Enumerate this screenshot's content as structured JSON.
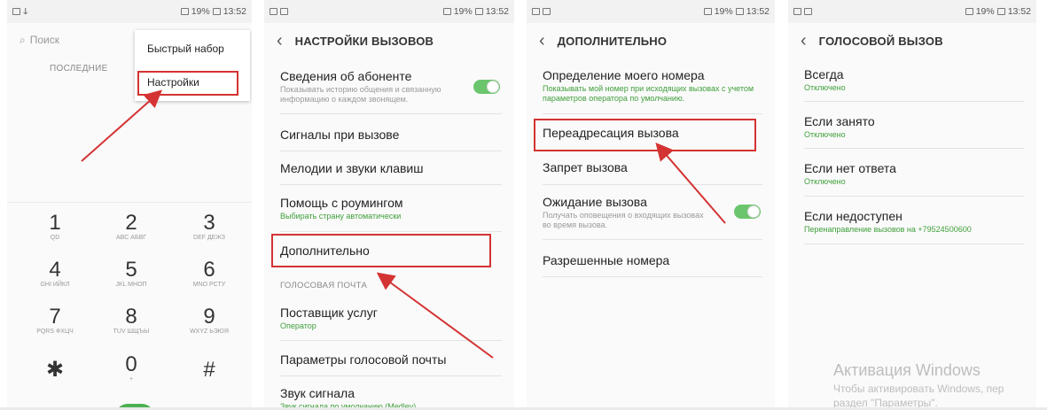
{
  "status": {
    "left": "",
    "right": "19%",
    "time": "13:52"
  },
  "panel1": {
    "search_placeholder": "Поиск",
    "recent_label": "ПОСЛЕДНИЕ",
    "menu": [
      "Быстрый набор",
      "Настройки"
    ],
    "keys": [
      {
        "d": "1",
        "l": "QD"
      },
      {
        "d": "2",
        "l": "ABC АБВГ"
      },
      {
        "d": "3",
        "l": "DEF ДЕЖЗ"
      },
      {
        "d": "4",
        "l": "GHI ИЙКЛ"
      },
      {
        "d": "5",
        "l": "JKL МНОП"
      },
      {
        "d": "6",
        "l": "MNO РСТУ"
      },
      {
        "d": "7",
        "l": "PQRS ФХЦЧ"
      },
      {
        "d": "8",
        "l": "TUV ШЩЪЫ"
      },
      {
        "d": "9",
        "l": "WXYZ ЬЭЮЯ"
      },
      {
        "d": "✱",
        "l": ""
      },
      {
        "d": "0",
        "l": "+"
      },
      {
        "d": "#",
        "l": ""
      }
    ]
  },
  "panel2": {
    "title": "НАСТРОЙКИ ВЫЗОВОВ",
    "caller_id_title": "Сведения об абоненте",
    "caller_id_sub": "Показывать историю общения и связанную информацию о каждом звонящем.",
    "ringtones": "Сигналы при вызове",
    "keytones": "Мелодии и звуки клавиш",
    "roaming_title": "Помощь с роумингом",
    "roaming_sub": "Выбирать страну автоматически",
    "advanced": "Дополнительно",
    "voicemail_section": "ГОЛОСОВАЯ ПОЧТА",
    "provider_title": "Поставщик услуг",
    "provider_sub": "Оператор",
    "voicemail_settings": "Параметры голосовой почты",
    "sound_title": "Звук сигнала",
    "sound_sub": "Звук сигнала по умолчанию (Medley)"
  },
  "panel3": {
    "title": "ДОПОЛНИТЕЛЬНО",
    "my_number_title": "Определение моего номера",
    "my_number_sub": "Показывать мой номер при исходящих вызовах с учетом параметров оператора по умолчанию.",
    "forwarding": "Переадресация вызова",
    "barring": "Запрет вызова",
    "waiting_title": "Ожидание вызова",
    "waiting_sub": "Получать оповещения о входящих вызовах во время вызова.",
    "fdn": "Разрешенные номера"
  },
  "panel4": {
    "title": "ГОЛОСОВОЙ ВЫЗОВ",
    "items": [
      {
        "title": "Всегда",
        "sub": "Отключено"
      },
      {
        "title": "Если занято",
        "sub": "Отключено"
      },
      {
        "title": "Если нет ответа",
        "sub": "Отключено"
      },
      {
        "title": "Если недоступен",
        "sub": "Перенаправление вызовов на +79524500600"
      }
    ]
  },
  "watermark": {
    "line1": "Активация Windows",
    "line2": "Чтобы активировать Windows, пер",
    "line3": "раздел \"Параметры\"."
  },
  "colors": {
    "accent_green": "#3f9f3a",
    "toggle_green": "#6bc56d",
    "highlight_red": "#d43333"
  }
}
